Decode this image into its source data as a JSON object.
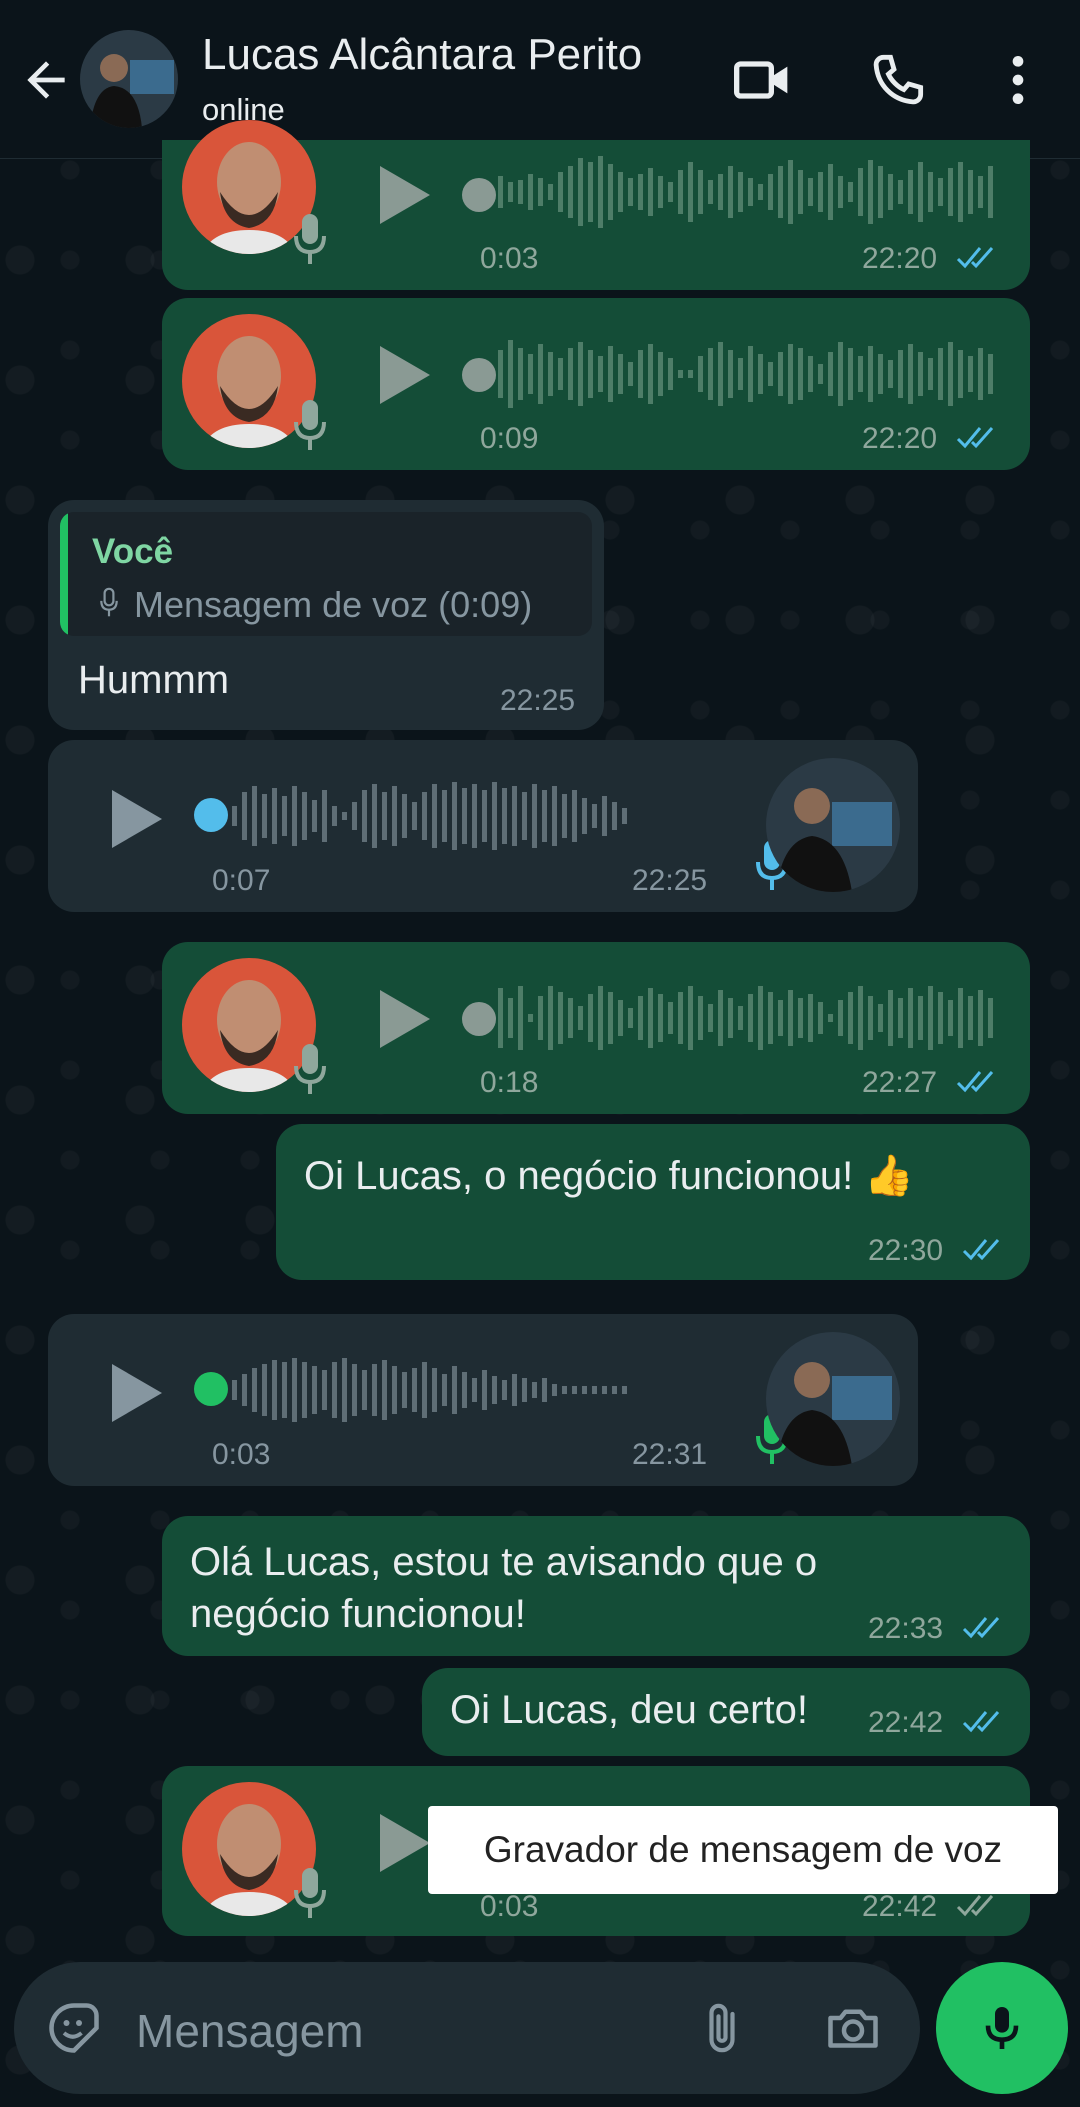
{
  "header": {
    "contact_name": "Lucas Alcântara Perito",
    "status": "online",
    "back_icon": "arrow-left-icon",
    "video_icon": "videocam-icon",
    "call_icon": "phone-icon",
    "menu_icon": "more-vert-icon"
  },
  "messages": [
    {
      "type": "voice",
      "direction": "out",
      "duration": "0:03",
      "time": "22:20",
      "ticks": "read"
    },
    {
      "type": "voice",
      "direction": "out",
      "duration": "0:09",
      "time": "22:20",
      "ticks": "read"
    },
    {
      "type": "text_reply",
      "direction": "in",
      "quote_author": "Você",
      "quote_text": "Mensagem de voz (0:09)",
      "text": "Hummm",
      "time": "22:25"
    },
    {
      "type": "voice",
      "direction": "in",
      "duration": "0:07",
      "time": "22:25"
    },
    {
      "type": "voice",
      "direction": "out",
      "duration": "0:18",
      "time": "22:27",
      "ticks": "read"
    },
    {
      "type": "text",
      "direction": "out",
      "text": "Oi Lucas, o negócio funcionou! 👍",
      "time": "22:30",
      "ticks": "read"
    },
    {
      "type": "voice",
      "direction": "in",
      "duration": "0:03",
      "time": "22:31"
    },
    {
      "type": "text",
      "direction": "out",
      "text_line1": "Olá Lucas, estou te avisando que o",
      "text_line2": "negócio funcionou!",
      "time": "22:33",
      "ticks": "read"
    },
    {
      "type": "text",
      "direction": "out",
      "text": "Oi Lucas, deu certo!",
      "time": "22:42",
      "ticks": "read"
    },
    {
      "type": "voice",
      "direction": "out",
      "duration": "0:03",
      "time": "22:42",
      "ticks": "sent"
    }
  ],
  "toast": "Gravador de mensagem de voz",
  "input": {
    "placeholder": "Mensagem"
  },
  "colors": {
    "outgoing_bubble": "#144d37",
    "incoming_bubble": "#1f2c33",
    "read_ticks": "#53bdeb",
    "accent_green": "#21c063",
    "played_blue": "#53bdeb"
  }
}
